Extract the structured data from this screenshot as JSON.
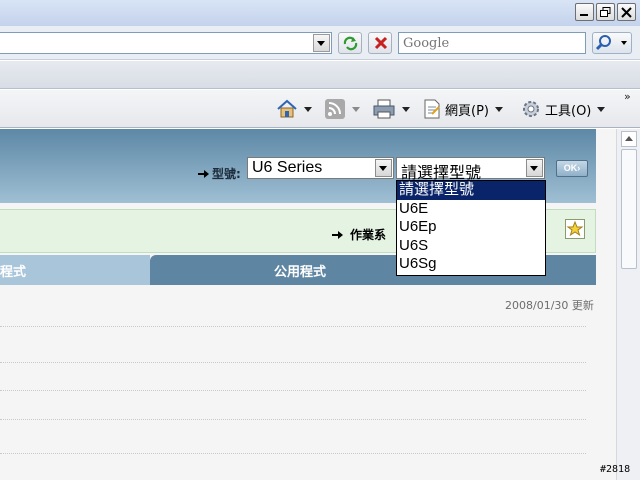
{
  "browser": {
    "search_placeholder": "Google"
  },
  "command_bar": {
    "page_label": "網頁(P)",
    "tools_label": "工具(O)",
    "more": "»"
  },
  "content": {
    "model_label": "型號:",
    "series_select_value": "U6 Series",
    "model_select_value": "請選擇型號",
    "ok_button": "OK",
    "os_label": "作業系",
    "tabs": [
      "程式",
      "公用程式"
    ],
    "updated": "2008/01/30 更新",
    "dropdown_options": [
      "請選擇型號",
      "U6E",
      "U6Ep",
      "U6S",
      "U6Sg"
    ]
  },
  "badge": "#2818"
}
